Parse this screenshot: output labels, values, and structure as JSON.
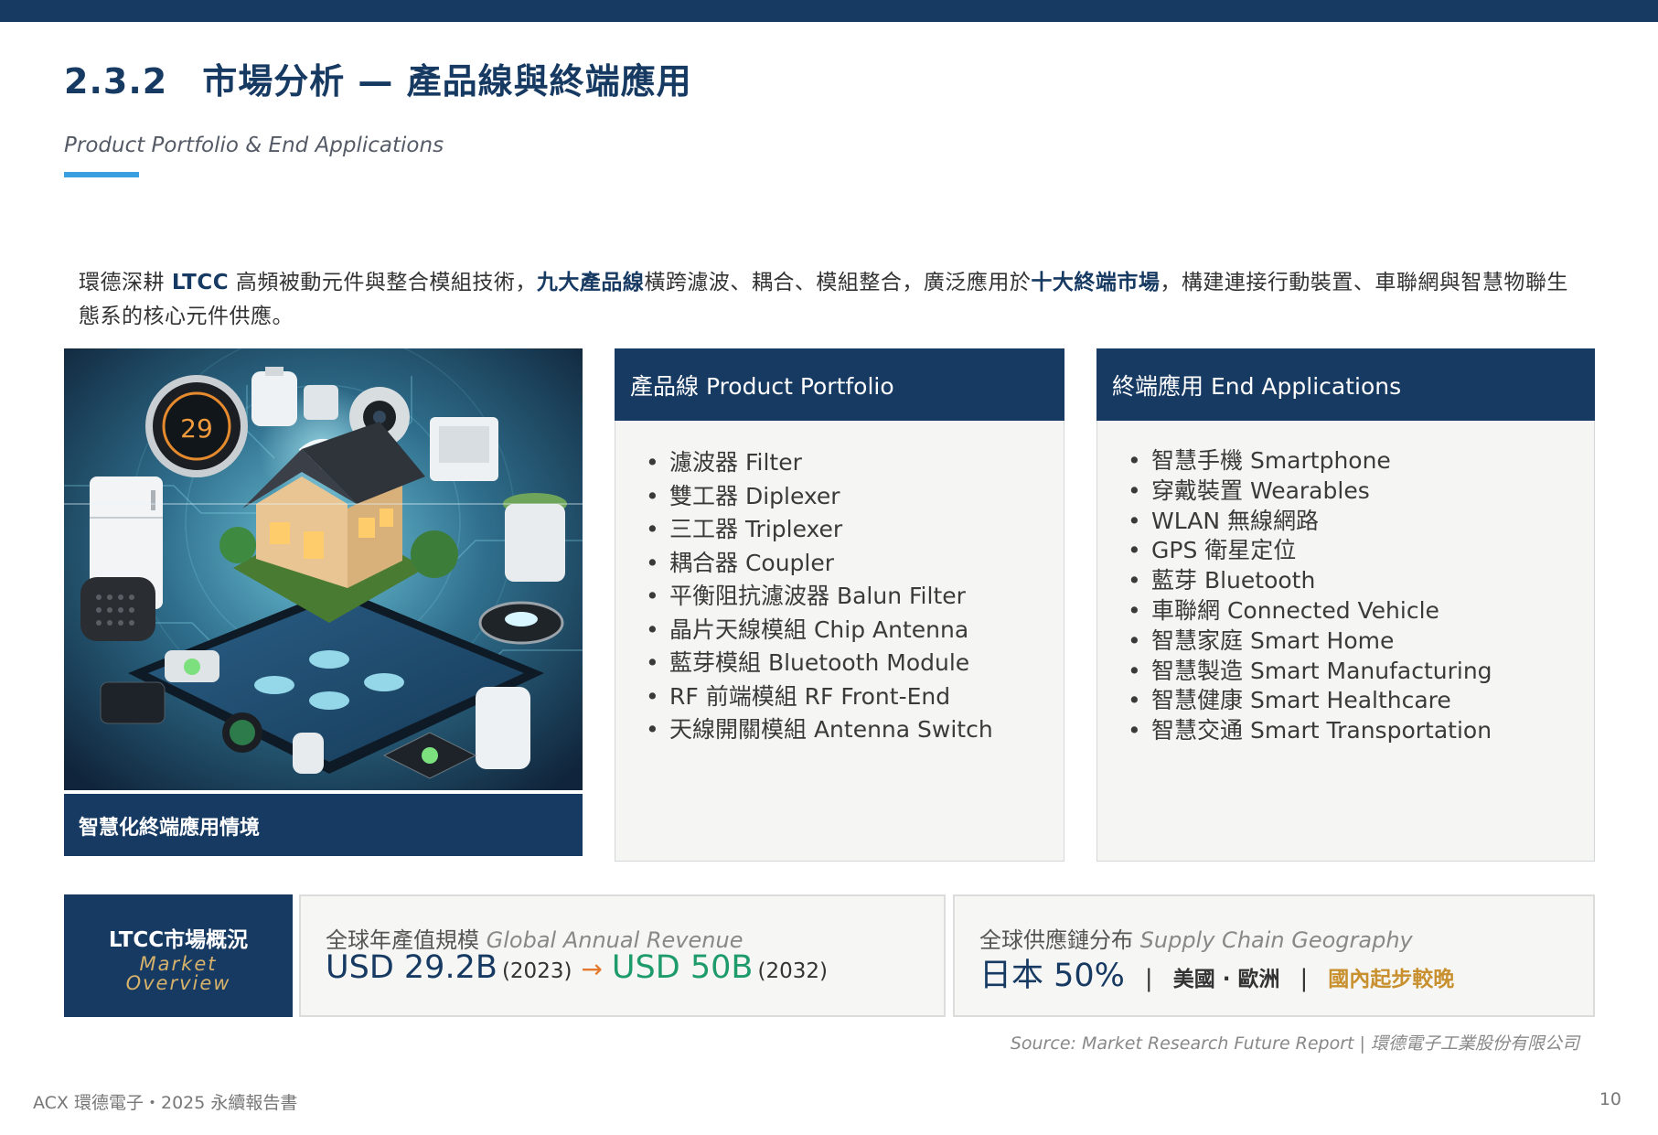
{
  "header": {
    "section_number": "2.3.2",
    "title": "市場分析 — 產品線與終端應用",
    "subtitle": "Product Portfolio & End Applications"
  },
  "intro": {
    "p1": "環德深耕 ",
    "p2": "LTCC",
    "p3": " 高頻被動元件與整合模組技術，",
    "p4": "九大產品線",
    "p5": "橫跨濾波、耦合、模組整合，廣泛應用於",
    "p6": "十大終端市場",
    "p7": "，構建連接行動裝置、車聯網與智慧物聯生態系的核心元件供應。"
  },
  "image_panel": {
    "thermostat_value": "29",
    "caption": "智慧化終端應用情境"
  },
  "products": {
    "title": "產品線 Product Portfolio",
    "items": [
      "濾波器 Filter",
      "雙工器 Diplexer",
      "三工器 Triplexer",
      "耦合器 Coupler",
      "平衡阻抗濾波器 Balun Filter",
      "晶片天線模組 Chip Antenna",
      "藍芽模組 Bluetooth Module",
      "RF 前端模組 RF Front-End",
      "天線開關模組 Antenna Switch"
    ]
  },
  "applications": {
    "title": "終端應用 End Applications",
    "items": [
      "智慧手機 Smartphone",
      "穿戴裝置 Wearables",
      "WLAN 無線網路",
      "GPS 衛星定位",
      "藍芽 Bluetooth",
      "車聯網 Connected Vehicle",
      "智慧家庭 Smart Home",
      "智慧製造 Smart Manufacturing",
      "智慧健康 Smart Healthcare",
      "智慧交通 Smart Transportation"
    ]
  },
  "market": {
    "label_zh": "LTCC市場概況",
    "label_en_1": "Market",
    "label_en_2": "Overview",
    "revenue": {
      "label_zh": "全球年產值規模 ",
      "label_en": "Global Annual Revenue",
      "value_from": "USD 29.2B",
      "year_from": "(2023)",
      "arrow": "→",
      "value_to": "USD 50B",
      "year_to": "(2032)"
    },
    "geography": {
      "label_zh": "全球供應鏈分布 ",
      "label_en": "Supply Chain Geography",
      "japan": "日本 50%",
      "sep1": "|",
      "others": "美國 · 歐洲",
      "sep2": "|",
      "domestic": "國內起步較晚"
    }
  },
  "source": "Source: Market Research Future Report | 環德電子工業股份有限公司",
  "footer": {
    "left": "ACX 環德電子・2025 永續報告書",
    "page": "10"
  },
  "colors": {
    "navy": "#173a63",
    "accent_blue": "#3a9fe0",
    "green": "#1d9b6b",
    "gold": "#c8902f",
    "arrow_orange": "#e2792c"
  }
}
